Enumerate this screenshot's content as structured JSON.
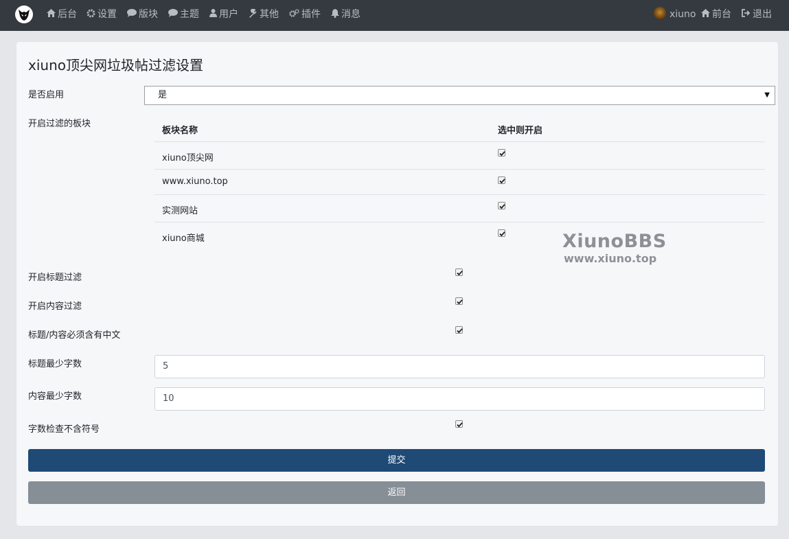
{
  "nav": {
    "items": [
      {
        "icon": "home-icon",
        "label": "后台"
      },
      {
        "icon": "gear-icon",
        "label": "设置"
      },
      {
        "icon": "comment-icon",
        "label": "版块"
      },
      {
        "icon": "comment-icon",
        "label": "主题"
      },
      {
        "icon": "user-icon",
        "label": "用户"
      },
      {
        "icon": "wrench-icon",
        "label": "其他"
      },
      {
        "icon": "gears-icon",
        "label": "插件"
      },
      {
        "icon": "bell-icon",
        "label": "消息"
      }
    ],
    "username": "xiuno",
    "front": "前台",
    "logout": "退出"
  },
  "page": {
    "title": "xiuno顶尖网垃圾帖过滤设置",
    "enable": {
      "label": "是否启用",
      "value": "是"
    },
    "forums": {
      "label": "开启过滤的板块",
      "col_name": "板块名称",
      "col_check": "选中则开启",
      "rows": [
        {
          "name": "xiuno顶尖网",
          "checked": true
        },
        {
          "name": "www.xiuno.top",
          "checked": true
        },
        {
          "name": "实测网站",
          "checked": true
        },
        {
          "name": "xiuno商城",
          "checked": true
        }
      ]
    },
    "title_filter": {
      "label": "开启标题过滤",
      "checked": true
    },
    "content_filter": {
      "label": "开启内容过滤",
      "checked": true
    },
    "chinese_required": {
      "label": "标题/内容必须含有中文",
      "checked": true
    },
    "title_min": {
      "label": "标题最少字数",
      "value": "5"
    },
    "content_min": {
      "label": "内容最少字数",
      "value": "10"
    },
    "no_symbols": {
      "label": "字数检查不含符号",
      "checked": true
    },
    "submit": "提交",
    "back": "返回"
  },
  "watermark": {
    "line1": "XiunoBBS",
    "line2": "www.xiuno.top"
  }
}
